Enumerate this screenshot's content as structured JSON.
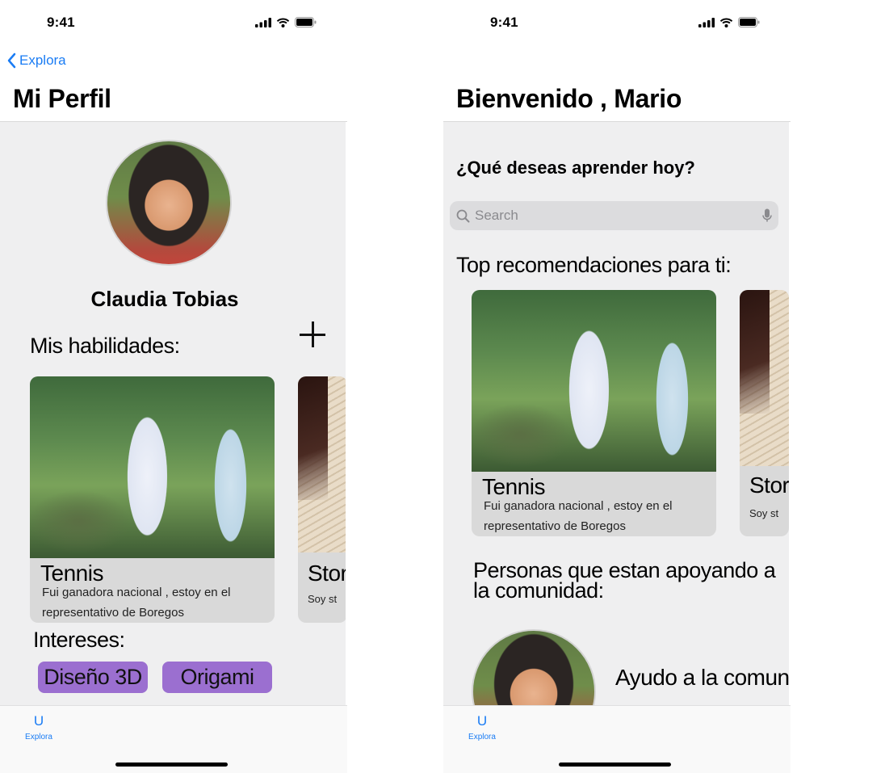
{
  "colors": {
    "accent": "#1a7cf4",
    "chip": "#9b6fd0",
    "card": "#d9d9d9",
    "background": "#efeff0"
  },
  "status": {
    "time": "9:41"
  },
  "profile": {
    "back_label": "Explora",
    "title": "Mi Perfil",
    "name": "Claudia Tobias",
    "skills_label": "Mis habilidades:",
    "skills": [
      {
        "title": "Tennis",
        "desc_line1": "Fui ganadora nacional , estoy en el",
        "desc_line2": "representativo de Boregos"
      },
      {
        "title": "Story",
        "desc": "Soy  st"
      }
    ],
    "interests_label": "Intereses:",
    "interests": [
      "Diseño 3D",
      "Origami"
    ]
  },
  "home": {
    "title": "Bienvenido , Mario",
    "question": "¿Qué deseas aprender hoy?",
    "search_placeholder": "Search",
    "top_label": "Top recomendaciones para ti:",
    "recommendations": [
      {
        "title": "Tennis",
        "desc_line1": "Fui ganadora nacional , estoy en el",
        "desc_line2": "representativo de Boregos"
      },
      {
        "title": "Story",
        "desc": "Soy  st"
      }
    ],
    "community_line1": "Personas que estan apoyando a",
    "community_line2": "la comunidad:",
    "person_text": "Ayudo a la comuni"
  },
  "tabbar": {
    "icon": "U",
    "label": "Explora"
  }
}
